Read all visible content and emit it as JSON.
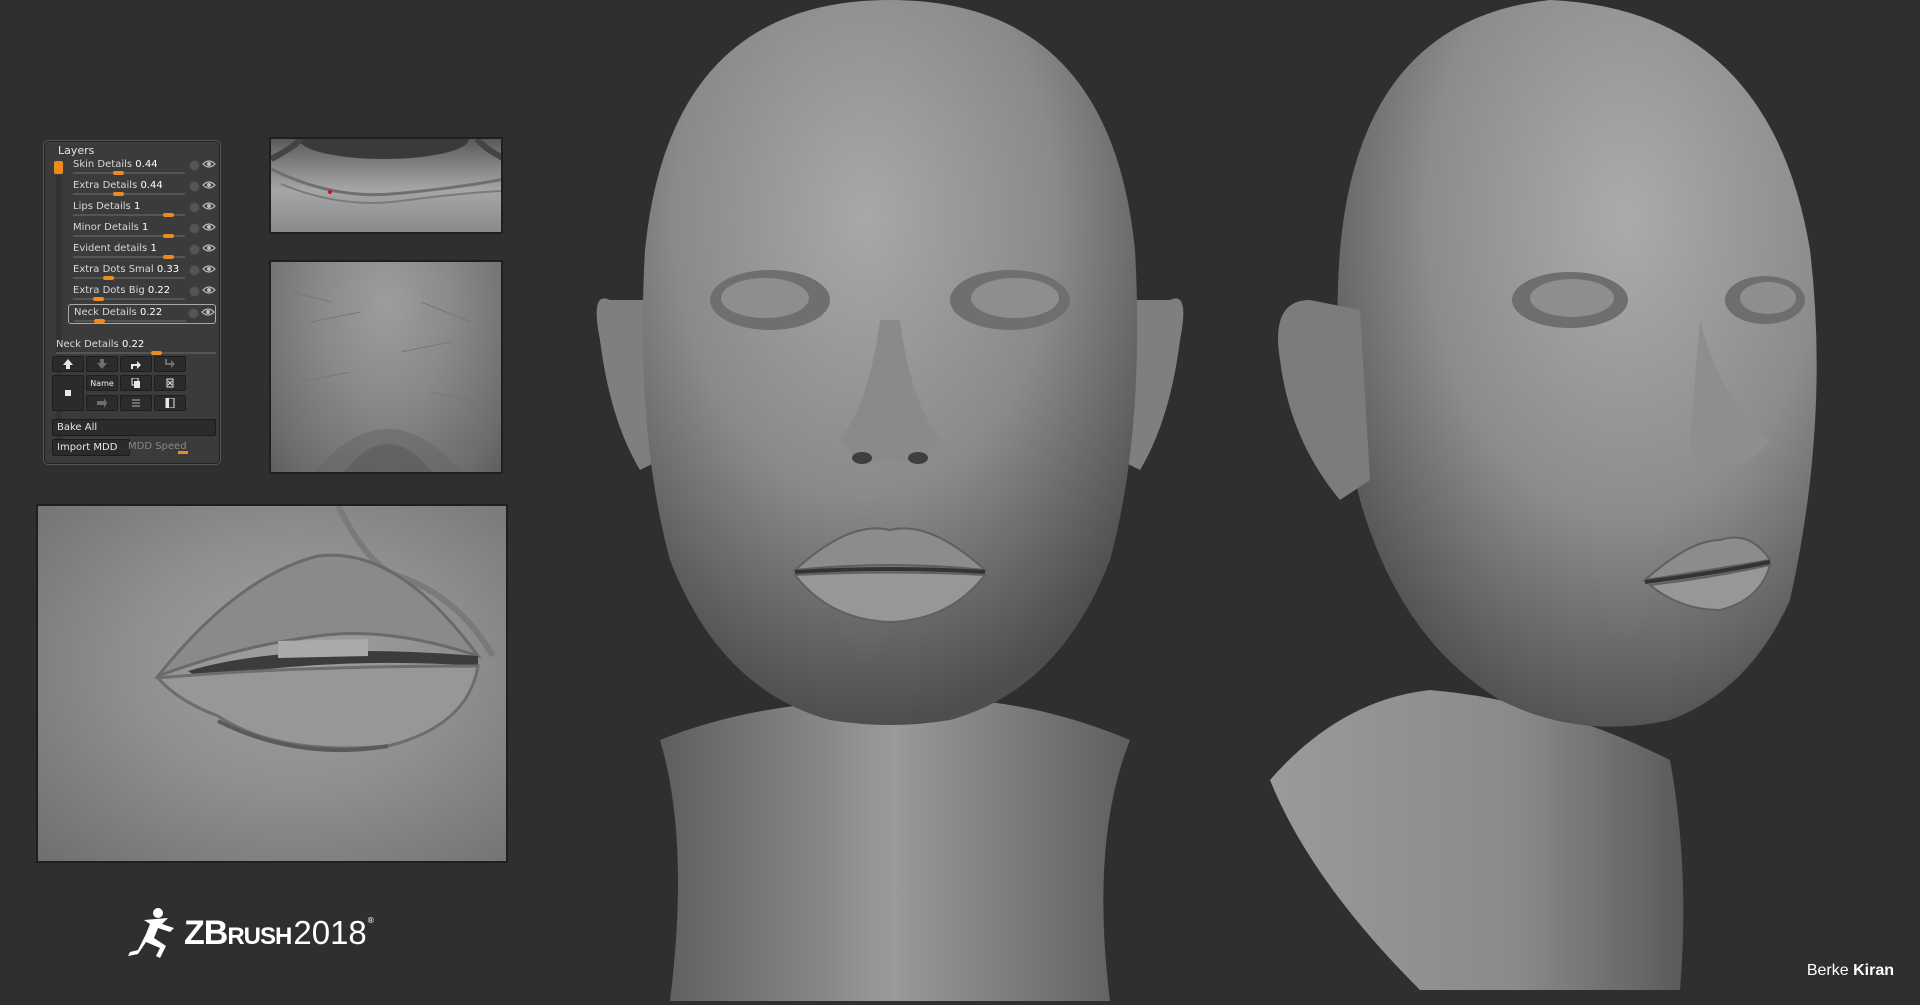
{
  "layers_panel": {
    "title": "Layers",
    "layers": [
      {
        "name": "Skin Details",
        "value": "0.44",
        "level": 0.44
      },
      {
        "name": "Extra Details",
        "value": "0.44",
        "level": 0.44
      },
      {
        "name": "Lips Details",
        "value": "1",
        "level": 1
      },
      {
        "name": "Minor Details",
        "value": "1",
        "level": 1
      },
      {
        "name": "Evident details",
        "value": "1",
        "level": 1
      },
      {
        "name": "Extra Dots Smal",
        "value": "0.33",
        "level": 0.33
      },
      {
        "name": "Extra Dots Big",
        "value": "0.22",
        "level": 0.22
      },
      {
        "name": "Neck Details",
        "value": "0.22",
        "level": 0.22
      }
    ],
    "current_layer": {
      "name": "Neck Details",
      "value": "0.22",
      "level": 0.22
    },
    "buttons": {
      "name_label": "Name",
      "bake_all": "Bake All",
      "import_mdd": "Import MDD",
      "mdd_speed": "MDD Speed"
    }
  },
  "logo": {
    "z": "Z",
    "brush_b": "B",
    "brush_rest": "RUSH",
    "year": "2018",
    "reg": "®"
  },
  "credit": {
    "first": "Berke",
    "last": "Kiran"
  },
  "colors": {
    "background": "#2f2f30",
    "accent": "#f08a1c",
    "panel": "#3b3b3c"
  }
}
